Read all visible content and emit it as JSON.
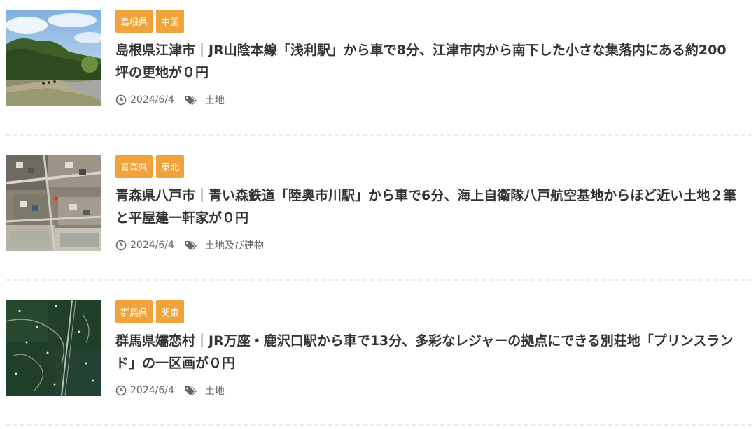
{
  "posts": [
    {
      "tags": [
        "島根県",
        "中国"
      ],
      "title": "島根県江津市｜JR山陰本線「浅利駅」から車で8分、江津市内から南下した小さな集落内にある約200坪の更地が０円",
      "date": "2024/6/4",
      "category": "土地",
      "thumbnail": "rural-lot-photo"
    },
    {
      "tags": [
        "青森県",
        "東北"
      ],
      "title": "青森県八戸市｜青い森鉄道「陸奥市川駅」から車で6分、海上自衛隊八戸航空基地からほど近い土地２筆と平屋建一軒家が０円",
      "date": "2024/6/4",
      "category": "土地及び建物",
      "thumbnail": "aerial-neighborhood-photo"
    },
    {
      "tags": [
        "群馬県",
        "関東"
      ],
      "title": "群馬県嬬恋村｜JR万座・鹿沢口駅から車で13分、多彩なレジャーの拠点にできる別荘地「プリンスランド」の一区画が０円",
      "date": "2024/6/4",
      "category": "土地",
      "thumbnail": "aerial-forest-map"
    }
  ],
  "colors": {
    "tag_bg": "#f0a33a",
    "tag_text": "#ffffff",
    "title": "#333333",
    "meta": "#666666"
  },
  "icons": {
    "date": "clock-icon",
    "category": "tag-icon"
  }
}
